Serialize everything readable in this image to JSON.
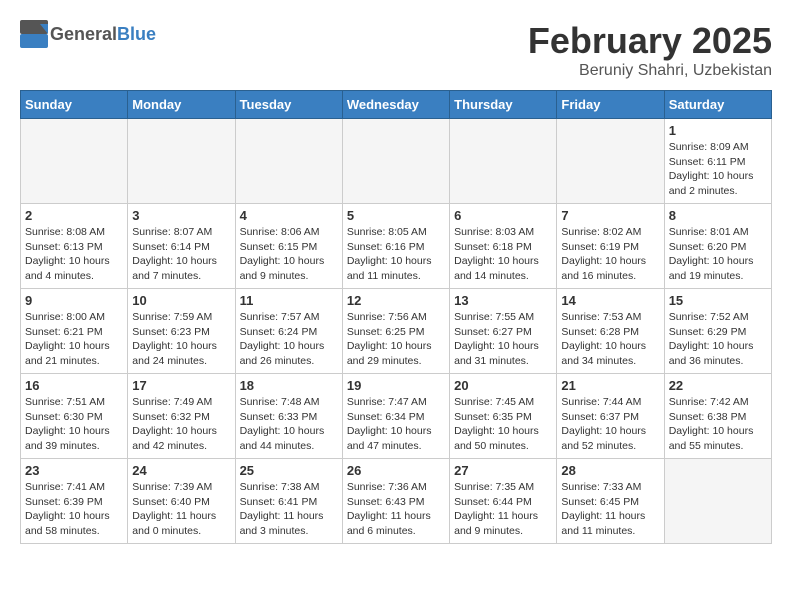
{
  "logo": {
    "general": "General",
    "blue": "Blue"
  },
  "title": "February 2025",
  "location": "Beruniy Shahri, Uzbekistan",
  "weekdays": [
    "Sunday",
    "Monday",
    "Tuesday",
    "Wednesday",
    "Thursday",
    "Friday",
    "Saturday"
  ],
  "weeks": [
    [
      {
        "day": "",
        "info": ""
      },
      {
        "day": "",
        "info": ""
      },
      {
        "day": "",
        "info": ""
      },
      {
        "day": "",
        "info": ""
      },
      {
        "day": "",
        "info": ""
      },
      {
        "day": "",
        "info": ""
      },
      {
        "day": "1",
        "info": "Sunrise: 8:09 AM\nSunset: 6:11 PM\nDaylight: 10 hours\nand 2 minutes."
      }
    ],
    [
      {
        "day": "2",
        "info": "Sunrise: 8:08 AM\nSunset: 6:13 PM\nDaylight: 10 hours\nand 4 minutes."
      },
      {
        "day": "3",
        "info": "Sunrise: 8:07 AM\nSunset: 6:14 PM\nDaylight: 10 hours\nand 7 minutes."
      },
      {
        "day": "4",
        "info": "Sunrise: 8:06 AM\nSunset: 6:15 PM\nDaylight: 10 hours\nand 9 minutes."
      },
      {
        "day": "5",
        "info": "Sunrise: 8:05 AM\nSunset: 6:16 PM\nDaylight: 10 hours\nand 11 minutes."
      },
      {
        "day": "6",
        "info": "Sunrise: 8:03 AM\nSunset: 6:18 PM\nDaylight: 10 hours\nand 14 minutes."
      },
      {
        "day": "7",
        "info": "Sunrise: 8:02 AM\nSunset: 6:19 PM\nDaylight: 10 hours\nand 16 minutes."
      },
      {
        "day": "8",
        "info": "Sunrise: 8:01 AM\nSunset: 6:20 PM\nDaylight: 10 hours\nand 19 minutes."
      }
    ],
    [
      {
        "day": "9",
        "info": "Sunrise: 8:00 AM\nSunset: 6:21 PM\nDaylight: 10 hours\nand 21 minutes."
      },
      {
        "day": "10",
        "info": "Sunrise: 7:59 AM\nSunset: 6:23 PM\nDaylight: 10 hours\nand 24 minutes."
      },
      {
        "day": "11",
        "info": "Sunrise: 7:57 AM\nSunset: 6:24 PM\nDaylight: 10 hours\nand 26 minutes."
      },
      {
        "day": "12",
        "info": "Sunrise: 7:56 AM\nSunset: 6:25 PM\nDaylight: 10 hours\nand 29 minutes."
      },
      {
        "day": "13",
        "info": "Sunrise: 7:55 AM\nSunset: 6:27 PM\nDaylight: 10 hours\nand 31 minutes."
      },
      {
        "day": "14",
        "info": "Sunrise: 7:53 AM\nSunset: 6:28 PM\nDaylight: 10 hours\nand 34 minutes."
      },
      {
        "day": "15",
        "info": "Sunrise: 7:52 AM\nSunset: 6:29 PM\nDaylight: 10 hours\nand 36 minutes."
      }
    ],
    [
      {
        "day": "16",
        "info": "Sunrise: 7:51 AM\nSunset: 6:30 PM\nDaylight: 10 hours\nand 39 minutes."
      },
      {
        "day": "17",
        "info": "Sunrise: 7:49 AM\nSunset: 6:32 PM\nDaylight: 10 hours\nand 42 minutes."
      },
      {
        "day": "18",
        "info": "Sunrise: 7:48 AM\nSunset: 6:33 PM\nDaylight: 10 hours\nand 44 minutes."
      },
      {
        "day": "19",
        "info": "Sunrise: 7:47 AM\nSunset: 6:34 PM\nDaylight: 10 hours\nand 47 minutes."
      },
      {
        "day": "20",
        "info": "Sunrise: 7:45 AM\nSunset: 6:35 PM\nDaylight: 10 hours\nand 50 minutes."
      },
      {
        "day": "21",
        "info": "Sunrise: 7:44 AM\nSunset: 6:37 PM\nDaylight: 10 hours\nand 52 minutes."
      },
      {
        "day": "22",
        "info": "Sunrise: 7:42 AM\nSunset: 6:38 PM\nDaylight: 10 hours\nand 55 minutes."
      }
    ],
    [
      {
        "day": "23",
        "info": "Sunrise: 7:41 AM\nSunset: 6:39 PM\nDaylight: 10 hours\nand 58 minutes."
      },
      {
        "day": "24",
        "info": "Sunrise: 7:39 AM\nSunset: 6:40 PM\nDaylight: 11 hours\nand 0 minutes."
      },
      {
        "day": "25",
        "info": "Sunrise: 7:38 AM\nSunset: 6:41 PM\nDaylight: 11 hours\nand 3 minutes."
      },
      {
        "day": "26",
        "info": "Sunrise: 7:36 AM\nSunset: 6:43 PM\nDaylight: 11 hours\nand 6 minutes."
      },
      {
        "day": "27",
        "info": "Sunrise: 7:35 AM\nSunset: 6:44 PM\nDaylight: 11 hours\nand 9 minutes."
      },
      {
        "day": "28",
        "info": "Sunrise: 7:33 AM\nSunset: 6:45 PM\nDaylight: 11 hours\nand 11 minutes."
      },
      {
        "day": "",
        "info": ""
      }
    ]
  ]
}
